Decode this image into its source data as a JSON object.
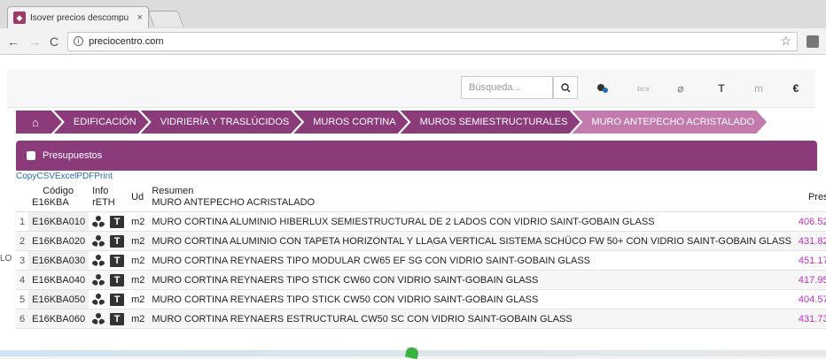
{
  "browser": {
    "tab_title": "Isover precios descompu",
    "tab_close": "×",
    "url": "preciocentro.com",
    "back": "←",
    "forward": "→",
    "reload": "C",
    "info": "i",
    "star": "☆"
  },
  "toolbar": {
    "search_placeholder": "Búsqueda...",
    "search_icon": "magnifier-icon",
    "icons": [
      "bcs",
      "clip",
      "T",
      "m",
      "€"
    ]
  },
  "breadcrumb": [
    "EDIFICACIÓN",
    "VIDRIERÍA Y TRASLÚCIDOS",
    "MUROS CORTINA",
    "MUROS SEMIESTRUCTURALES",
    "MURO ANTEPECHO ACRISTALADO"
  ],
  "home_icon": "⌂",
  "panel": {
    "title": "Presupuestos"
  },
  "export": {
    "copy": "Copy",
    "csv": "CSV",
    "excel": "Excel",
    "pdf": "PDF",
    "print": "Print"
  },
  "table": {
    "headers": {
      "code": "Código",
      "code_sub": "E16KBA",
      "info": "Info",
      "info_sub": "rETH",
      "unit": "Ud",
      "summary": "Resumen",
      "summary_sub": "MURO ANTEPECHO ACRISTALADO",
      "price": "Pres"
    },
    "rows": [
      {
        "n": "1",
        "code": "E16KBA010",
        "unit": "m2",
        "summary": "MURO CORTINA ALUMINIO HIBERLUX SEMIESTRUCTURAL DE 2 LADOS CON VIDRIO SAINT-GOBAIN GLASS",
        "price": "406.52"
      },
      {
        "n": "2",
        "code": "E16KBA020",
        "unit": "m2",
        "summary": "MURO CORTINA ALUMINIO CON TAPETA HORIZONTAL Y LLAGA VERTICAL SISTEMA SCHÜCO FW 50+ CON VIDRIO SAINT-GOBAIN GLASS",
        "price": "431.82"
      },
      {
        "n": "3",
        "code": "E16KBA030",
        "unit": "m2",
        "summary": "MURO CORTINA REYNAERS TIPO MODULAR CW65 EF SG CON VIDRIO SAINT-GOBAIN GLASS",
        "price": "451.17"
      },
      {
        "n": "4",
        "code": "E16KBA040",
        "unit": "m2",
        "summary": "MURO CORTINA REYNAERS TIPO STICK CW60 CON VIDRIO SAINT-GOBAIN GLASS",
        "price": "417.95"
      },
      {
        "n": "5",
        "code": "E16KBA050",
        "unit": "m2",
        "summary": "MURO CORTINA REYNAERS TIPO STICK CW50 CON VIDRIO SAINT-GOBAIN GLASS",
        "price": "404.57"
      },
      {
        "n": "6",
        "code": "E16KBA060",
        "unit": "m2",
        "summary": "MURO CORTINA REYNAERS ESTRUCTURAL CW50 SC CON VIDRIO SAINT-GOBAIN GLASS",
        "price": "431.73"
      }
    ]
  },
  "left_edge": "LO",
  "colors": {
    "primary": "#8b3a7a",
    "active_crumb": "#c37aac",
    "price": "#c030c0",
    "link": "#2a6cb8"
  }
}
